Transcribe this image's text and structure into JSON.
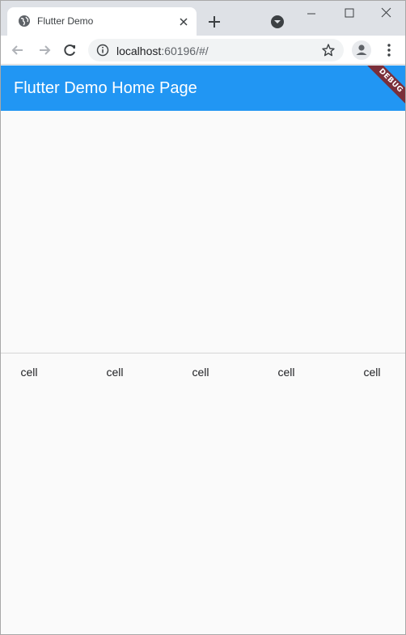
{
  "browser": {
    "tab_title": "Flutter Demo",
    "url_host": "localhost",
    "url_rest": ":60196/#/"
  },
  "app": {
    "title": "Flutter Demo Home Page",
    "debug_banner": "DEBUG",
    "appbar_color": "#2196f3",
    "cells": [
      "cell",
      "cell",
      "cell",
      "cell",
      "cell"
    ]
  },
  "icons": {
    "favicon": "globe-icon",
    "tab_close": "close-icon",
    "new_tab": "plus-icon",
    "tab_search": "chevron-down-icon",
    "back": "arrow-left-icon",
    "forward": "arrow-right-icon",
    "reload": "reload-icon",
    "site_info": "info-icon",
    "bookmark": "star-icon",
    "profile": "person-icon",
    "menu": "kebab-menu-icon"
  }
}
